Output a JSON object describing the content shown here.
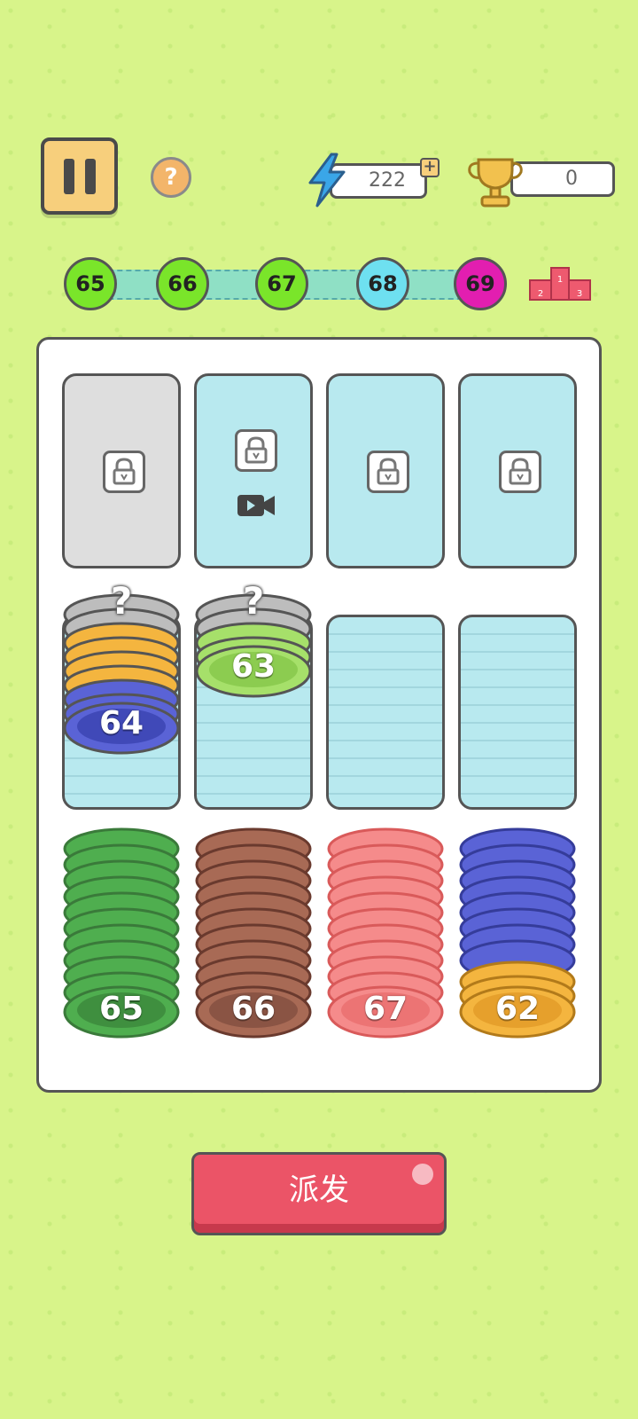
{
  "hud": {
    "energy_value": "222",
    "trophy_value": "0",
    "help_label": "?"
  },
  "levels": [
    {
      "label": "65",
      "color": "#7ae52a"
    },
    {
      "label": "66",
      "color": "#7ae52a"
    },
    {
      "label": "67",
      "color": "#7ae52a"
    },
    {
      "label": "68",
      "color": "#6ee0f0"
    },
    {
      "label": "69",
      "color": "#e21eb0"
    }
  ],
  "podium": {
    "left": "2",
    "center": "1",
    "right": "3"
  },
  "board": {
    "locked_slots": [
      {
        "style": "gray",
        "video": false
      },
      {
        "style": "blue",
        "video": true
      },
      {
        "style": "blue",
        "video": false
      },
      {
        "style": "blue",
        "video": false
      }
    ],
    "stacks": {
      "slot_5": {
        "top_label": "64",
        "hidden_label": "?"
      },
      "slot_6": {
        "top_label": "63",
        "hidden_label": "?"
      },
      "slot_9": {
        "top_label": "65"
      },
      "slot_10": {
        "top_label": "66"
      },
      "slot_11": {
        "top_label": "67"
      },
      "slot_12": {
        "top_label": "62"
      }
    }
  },
  "colors": {
    "background": "#d8f48a",
    "chip_gray": "#bdbdbd",
    "chip_orange": "#f4b53f",
    "chip_blue": "#5a63d6",
    "chip_lime": "#a6e06a",
    "chip_green": "#4fae4f",
    "chip_brown": "#a86a55",
    "chip_pink": "#f58b8b",
    "dispatch_red": "#eb5467"
  },
  "dispatch_label": "派发"
}
